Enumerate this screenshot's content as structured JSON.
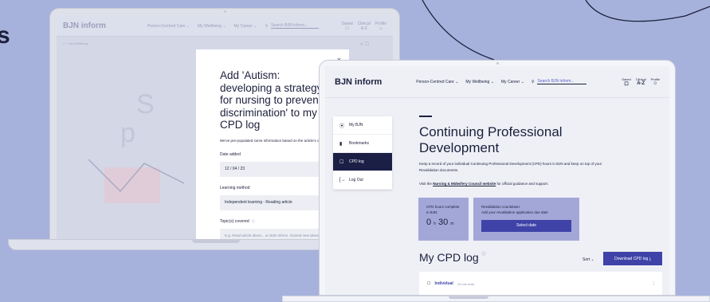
{
  "background": {
    "color": "#a7b2dc",
    "corner_glyph": "s"
  },
  "left_laptop": {
    "header": {
      "logo": "BJN inform",
      "nav": [
        "Person-Centred Care ⌄",
        "My Wellbeing ⌄",
        "My Career ⌄"
      ],
      "search_placeholder": "Search BJN inform...",
      "icons": [
        {
          "label": "Saved",
          "glyph": "☐"
        },
        {
          "label": "Clinical",
          "glyph": "A-Z"
        },
        {
          "label": "Profile",
          "glyph": "☺"
        }
      ]
    },
    "breadcrumb": "My Wellbeing",
    "modal": {
      "close": "×",
      "title": "Add 'Autism: developing a strategy for nursing to prevent discrimination' to my CPD log",
      "intro": "We've pre-populated some information based on the article's content.",
      "date_label": "Date added",
      "date_value": "12 / 04 / 23",
      "method_label": "Learning method",
      "method_value": "Independent learning - Reading article",
      "topics_label": "Topic(s) covered",
      "topics_hint": "ⓘ",
      "topics_placeholder": "E.g. Read article about... on BJN inform. Gained new ideas which I will reflect on and discuss with my team, with a view to making changes to our practice."
    }
  },
  "right_laptop": {
    "header": {
      "logo": "BJN inform",
      "nav": [
        "Person-Centred Care ⌄",
        "My Wellbeing ⌄",
        "My Career ⌄"
      ],
      "search_placeholder": "Search BJN inform...",
      "icons": [
        {
          "label": "Saved",
          "glyph": "☐"
        },
        {
          "label": "Clinical",
          "glyph": "A-Z"
        },
        {
          "label": "Profile",
          "glyph": "☺"
        }
      ]
    },
    "menu": [
      {
        "icon": "⦿",
        "label": "My BJN"
      },
      {
        "icon": "▮",
        "label": "Bookmarks"
      },
      {
        "icon": "☐",
        "label": "CPD log",
        "active": true
      },
      {
        "icon": "[→",
        "label": "Log Out"
      }
    ],
    "title": "Continuing Professional Development",
    "intro": "Keep a record of your individual Continuing Professional Development (CPD) hours in BJN and keep on top of your Revalidation documents.",
    "link_prefix": "Visit the ",
    "link_text": "Nursing & Midwifery Council website",
    "link_suffix": " for official guidance and support.",
    "cpd_card": {
      "label": "CPD hours complete in BJN:",
      "hours": "0",
      "h_unit": "h",
      "minutes": "30",
      "m_unit": "m"
    },
    "reval_card": {
      "label": "Revalidation countdown:",
      "text": "Add your revalidation application due date",
      "button": "Select date"
    },
    "log_title": "My CPD log",
    "log_info": "ⓘ",
    "sort": "Sort ⌄",
    "download": "Download CPD log ⤓",
    "row": {
      "icon": "☐",
      "type": "Individual",
      "read": "10 min read",
      "more": "⋮"
    }
  }
}
